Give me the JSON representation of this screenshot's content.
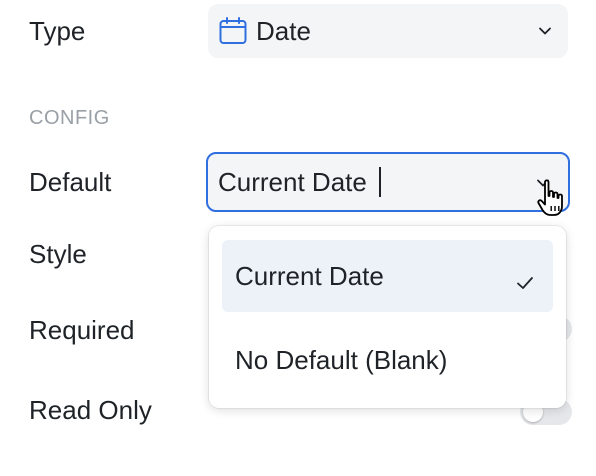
{
  "fields": {
    "type_label": "Type",
    "type_value": "Date",
    "section_heading": "CONFIG",
    "default_label": "Default",
    "default_value": "Current Date",
    "style_label": "Style",
    "required_label": "Required",
    "read_only_label": "Read Only"
  },
  "dropdown": {
    "options": [
      {
        "label": "Current Date",
        "selected": true
      },
      {
        "label": "No Default (Blank)",
        "selected": false
      }
    ]
  },
  "icons": {
    "type": "calendar-icon",
    "chevron": "chevron-down-icon",
    "check": "check-icon",
    "cursor": "hand-pointer-cursor"
  },
  "colors": {
    "focus_border": "#2f6fe0",
    "calendar_icon": "#2f6fe0",
    "selected_option_bg": "#edf1f8",
    "field_bg": "#f4f5f6"
  },
  "toggles": {
    "read_only_on": false
  }
}
